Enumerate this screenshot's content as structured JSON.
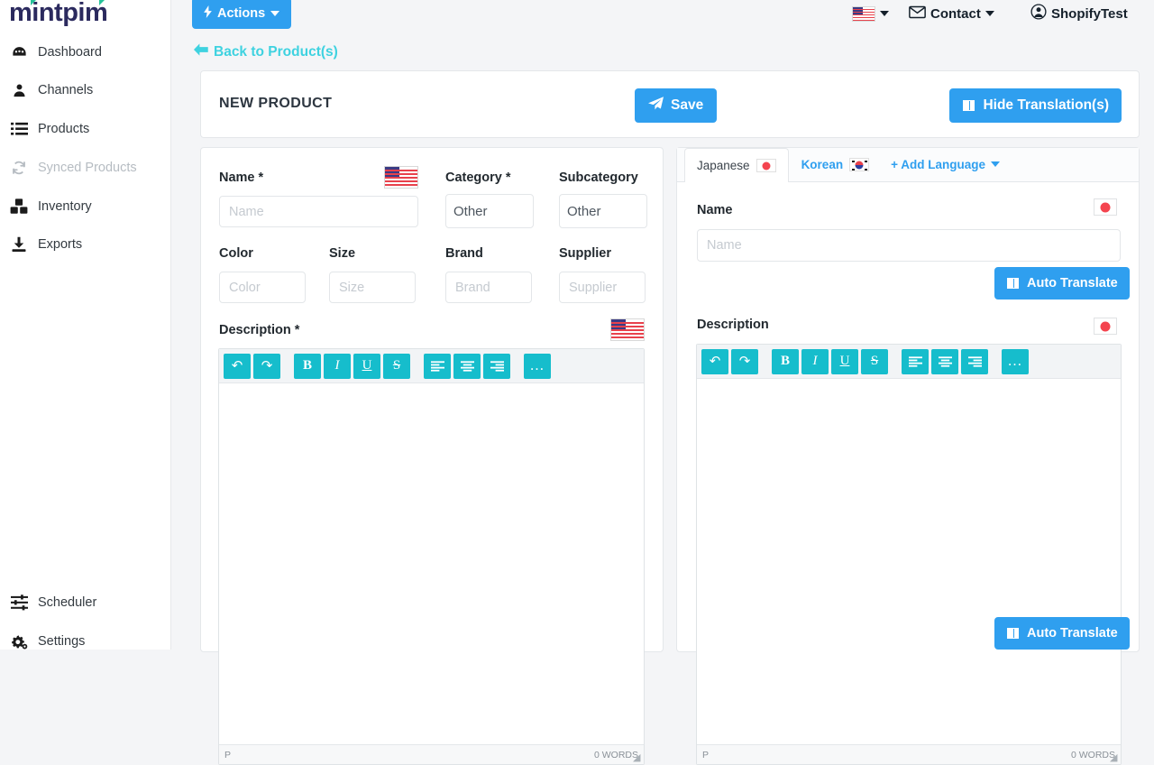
{
  "brand": {
    "logo": "mintpim"
  },
  "sidebar": {
    "items": [
      {
        "label": "Dashboard",
        "icon": "dashboard-icon",
        "dim": false
      },
      {
        "label": "Channels",
        "icon": "user-icon",
        "dim": false
      },
      {
        "label": "Products",
        "icon": "list-icon",
        "dim": false
      },
      {
        "label": "Synced Products",
        "icon": "sync-icon",
        "dim": true
      },
      {
        "label": "Inventory",
        "icon": "boxes-icon",
        "dim": false
      },
      {
        "label": "Exports",
        "icon": "download-icon",
        "dim": false
      }
    ],
    "bottom_items": [
      {
        "label": "Scheduler",
        "icon": "sliders-icon"
      },
      {
        "label": "Settings",
        "icon": "gears-icon"
      }
    ]
  },
  "topbar": {
    "actions_label": "Actions",
    "language_flag": "us-flag-icon",
    "contact_label": "Contact",
    "account_label": "ShopifyTest",
    "back_link": "Back to Product(s)"
  },
  "header": {
    "title": "NEW PRODUCT",
    "save_label": "Save",
    "hide_translations_label": "Hide Translation(s)"
  },
  "form": {
    "name": {
      "label": "Name *",
      "placeholder": "Name",
      "value": "",
      "flag": "us-flag-icon"
    },
    "category": {
      "label": "Category *",
      "value": "Other",
      "options": [
        "Other"
      ]
    },
    "subcategory": {
      "label": "Subcategory",
      "value": "Other",
      "options": [
        "Other"
      ]
    },
    "color": {
      "label": "Color",
      "placeholder": "Color",
      "value": ""
    },
    "size": {
      "label": "Size",
      "placeholder": "Size",
      "value": ""
    },
    "brand": {
      "label": "Brand",
      "placeholder": "Brand",
      "value": ""
    },
    "supplier": {
      "label": "Supplier",
      "placeholder": "Supplier",
      "value": ""
    },
    "description": {
      "label": "Description *",
      "flag": "us-flag-icon"
    }
  },
  "editor": {
    "toolbar": [
      {
        "name": "undo-icon",
        "glyph": "↶"
      },
      {
        "name": "redo-icon",
        "glyph": "↷"
      },
      {
        "name": "bold-icon",
        "glyph": "B"
      },
      {
        "name": "italic-icon",
        "glyph": "I"
      },
      {
        "name": "underline-icon",
        "glyph": "U"
      },
      {
        "name": "strikethrough-icon",
        "glyph": "S"
      },
      {
        "name": "align-left-icon",
        "glyph": "☰"
      },
      {
        "name": "align-center-icon",
        "glyph": "☰"
      },
      {
        "name": "align-right-icon",
        "glyph": "☰"
      },
      {
        "name": "more-options-icon",
        "glyph": "…"
      }
    ],
    "status_tag": "P",
    "word_count": "0 WORDS",
    "content": ""
  },
  "translation": {
    "tabs": [
      {
        "label": "Japanese",
        "flag": "jp-flag-icon",
        "active": true
      },
      {
        "label": "Korean",
        "flag": "kr-flag-icon",
        "active": false
      }
    ],
    "add_language_label": "+ Add Language",
    "name": {
      "label": "Name",
      "placeholder": "Name",
      "value": "",
      "flag": "jp-flag-icon"
    },
    "description": {
      "label": "Description",
      "flag": "jp-flag-icon"
    },
    "auto_translate_label": "Auto Translate"
  },
  "colors": {
    "accent_blue": "#2f9fef",
    "link_cyan": "#3ed2e0",
    "toolbar_teal": "#16bdcc",
    "logo_navy": "#2b2a5e",
    "logo_green": "#27c39a",
    "page_bg": "#f4f5f7"
  }
}
